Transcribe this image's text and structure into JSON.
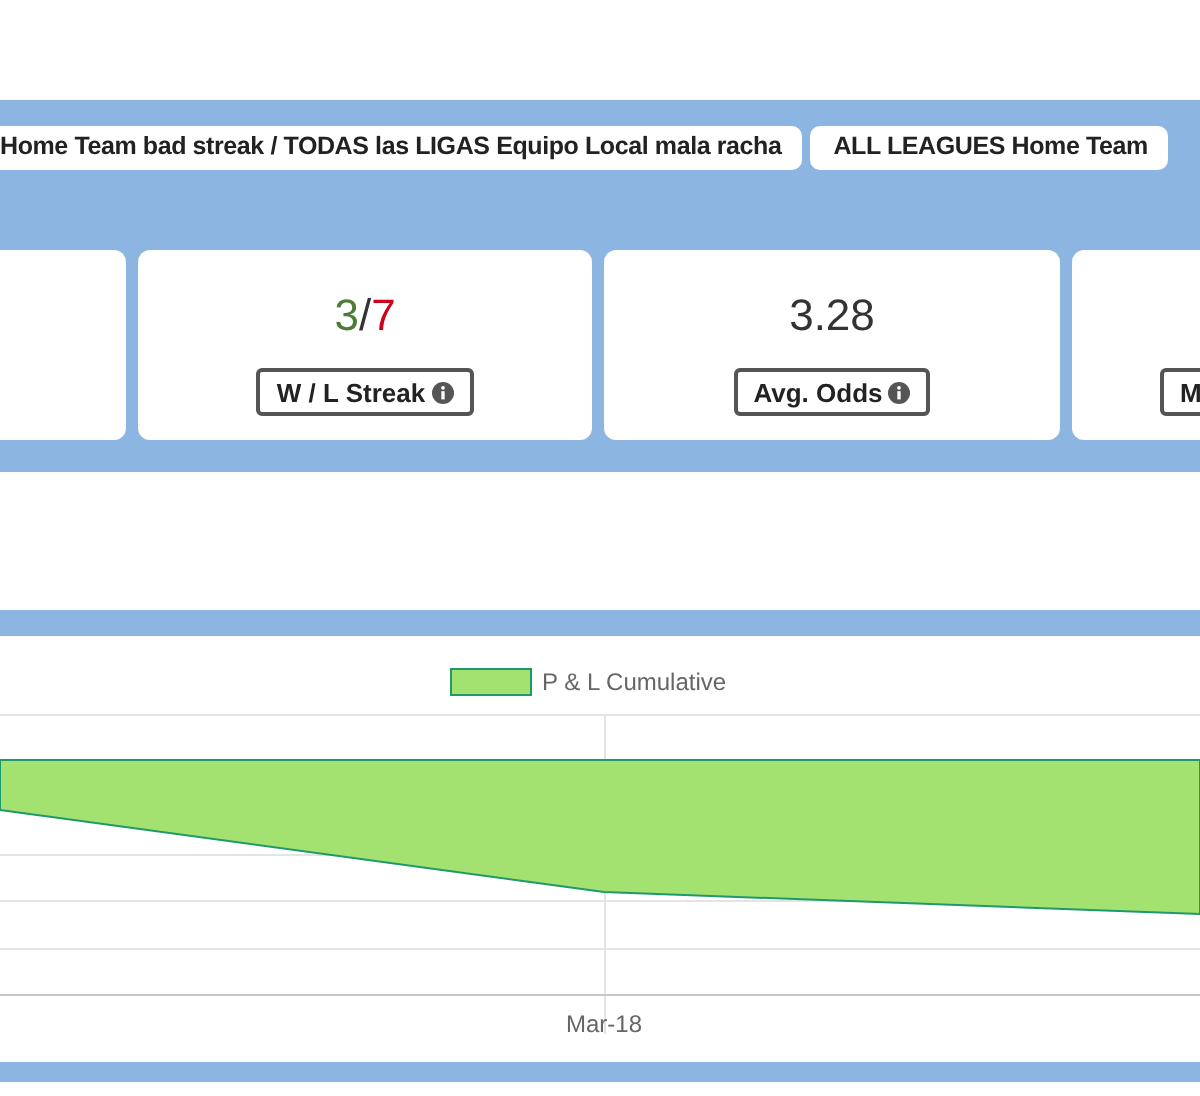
{
  "tags": [
    {
      "label": "Home Team bad streak / TODAS las LIGAS Equipo Local mala racha"
    },
    {
      "label": "ALL LEAGUES Home Team"
    }
  ],
  "stats": [
    {
      "parts": [
        {
          "text": "3",
          "kind": "win"
        },
        {
          "text": "/",
          "kind": "sep"
        },
        {
          "text": "7",
          "kind": "loss"
        }
      ],
      "label": "W / L Streak",
      "info": true
    },
    {
      "parts": [
        {
          "text": "3.28",
          "kind": "plain"
        }
      ],
      "label": "Avg. Odds",
      "info": true
    },
    {
      "label": "M"
    }
  ],
  "chart": {
    "legend": "P & L Cumulative",
    "x_label": "Mar-18"
  }
}
